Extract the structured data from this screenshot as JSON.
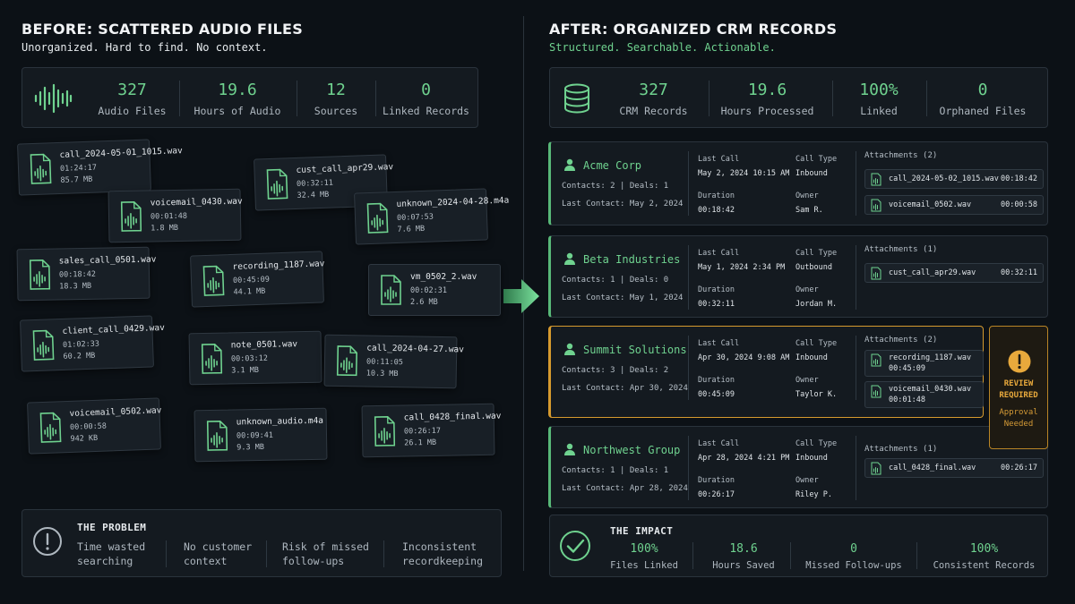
{
  "left": {
    "title": "BEFORE: SCATTERED AUDIO FILES",
    "subtitle": "Unorganized. Hard to find. No context.",
    "stats": [
      {
        "value": "327",
        "label": "Audio Files"
      },
      {
        "value": "19.6",
        "label": "Hours of Audio"
      },
      {
        "value": "12",
        "label": "Sources"
      },
      {
        "value": "0",
        "label": "Linked Records"
      }
    ],
    "files": [
      {
        "name": "call_2024-05-01_1015.wav",
        "duration": "01:24:17",
        "size": "85.7 MB"
      },
      {
        "name": "cust_call_apr29.wav",
        "duration": "00:32:11",
        "size": "32.4 MB"
      },
      {
        "name": "voicemail_0430.wav",
        "duration": "00:01:48",
        "size": "1.8 MB"
      },
      {
        "name": "unknown_2024-04-28.m4a",
        "duration": "00:07:53",
        "size": "7.6 MB"
      },
      {
        "name": "sales_call_0501.wav",
        "duration": "00:18:42",
        "size": "18.3 MB"
      },
      {
        "name": "recording_1187.wav",
        "duration": "00:45:09",
        "size": "44.1 MB"
      },
      {
        "name": "vm_0502_2.wav",
        "duration": "00:02:31",
        "size": "2.6 MB"
      },
      {
        "name": "client_call_0429.wav",
        "duration": "01:02:33",
        "size": "60.2 MB"
      },
      {
        "name": "note_0501.wav",
        "duration": "00:03:12",
        "size": "3.1 MB"
      },
      {
        "name": "call_2024-04-27.wav",
        "duration": "00:11:05",
        "size": "10.3 MB"
      },
      {
        "name": "voicemail_0502.wav",
        "duration": "00:00:58",
        "size": "942 KB"
      },
      {
        "name": "unknown_audio.m4a",
        "duration": "00:09:41",
        "size": "9.3 MB"
      },
      {
        "name": "call_0428_final.wav",
        "duration": "00:26:17",
        "size": "26.1 MB"
      }
    ],
    "problem": {
      "title": "THE PROBLEM",
      "items": [
        {
          "line1": "Time wasted",
          "line2": "searching"
        },
        {
          "line1": "No customer",
          "line2": "context"
        },
        {
          "line1": "Risk of missed",
          "line2": "follow-ups"
        },
        {
          "line1": "Inconsistent",
          "line2": "recordkeeping"
        }
      ]
    }
  },
  "right": {
    "title": "AFTER: ORGANIZED CRM RECORDS",
    "subtitle": "Structured. Searchable. Actionable.",
    "stats": [
      {
        "value": "327",
        "label": "CRM Records"
      },
      {
        "value": "19.6",
        "label": "Hours Processed"
      },
      {
        "value": "100%",
        "label": "Linked"
      },
      {
        "value": "0",
        "label": "Orphaned Files"
      }
    ],
    "labels": {
      "last_call": "Last Call",
      "call_type": "Call Type",
      "duration": "Duration",
      "owner": "Owner"
    },
    "records": [
      {
        "name": "Acme Corp",
        "contacts": "Contacts: 2  |  Deals: 1",
        "last_contact": "Last Contact: May 2, 2024",
        "last_call": "May 2, 2024  10:15 AM",
        "call_type": "Inbound",
        "duration": "00:18:42",
        "owner": "Sam R.",
        "attachments_title": "Attachments (2)",
        "attachments": [
          {
            "name": "call_2024-05-02_1015.wav",
            "duration": "00:18:42"
          },
          {
            "name": "voicemail_0502.wav",
            "duration": "00:00:58"
          }
        ]
      },
      {
        "name": "Beta Industries",
        "contacts": "Contacts: 1  |  Deals: 0",
        "last_contact": "Last Contact: May 1, 2024",
        "last_call": "May 1, 2024  2:34 PM",
        "call_type": "Outbound",
        "duration": "00:32:11",
        "owner": "Jordan M.",
        "attachments_title": "Attachments (1)",
        "attachments": [
          {
            "name": "cust_call_apr29.wav",
            "duration": "00:32:11"
          }
        ]
      },
      {
        "name": "Summit Solutions",
        "contacts": "Contacts: 3  |  Deals: 2",
        "last_contact": "Last Contact: Apr 30, 2024",
        "last_call": "Apr 30, 2024  9:08 AM",
        "call_type": "Inbound",
        "duration": "00:45:09",
        "owner": "Taylor K.",
        "attachments_title": "Attachments (2)",
        "attachments": [
          {
            "name": "recording_1187.wav",
            "duration": "00:45:09"
          },
          {
            "name": "voicemail_0430.wav",
            "duration": "00:01:48"
          }
        ]
      },
      {
        "name": "Northwest Group",
        "contacts": "Contacts: 1  |  Deals: 1",
        "last_contact": "Last Contact: Apr 28, 2024",
        "last_call": "Apr 28, 2024  4:21 PM",
        "call_type": "Inbound",
        "duration": "00:26:17",
        "owner": "Riley P.",
        "attachments_title": "Attachments (1)",
        "attachments": [
          {
            "name": "call_0428_final.wav",
            "duration": "00:26:17"
          }
        ]
      }
    ],
    "review": {
      "line1": "REVIEW",
      "line2": "REQUIRED",
      "line3": "Approval",
      "line4": "Needed"
    },
    "impact": {
      "title": "THE IMPACT",
      "stats": [
        {
          "value": "100%",
          "label": "Files Linked"
        },
        {
          "value": "18.6",
          "label": "Hours Saved"
        },
        {
          "value": "0",
          "label": "Missed Follow-ups"
        },
        {
          "value": "100%",
          "label": "Consistent Records"
        }
      ]
    }
  },
  "colors": {
    "background": "#0c1116",
    "accent_green": "#6fd28f",
    "warning_amber": "#e8a93c"
  }
}
